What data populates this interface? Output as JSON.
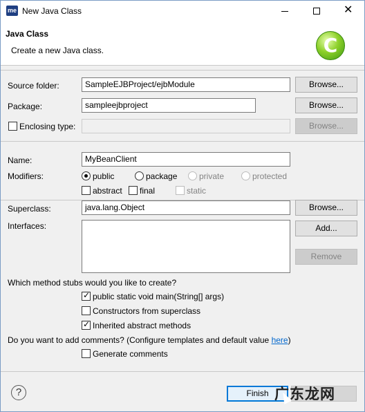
{
  "window": {
    "app_icon_text": "me",
    "title": "New Java Class",
    "minimize_icon": "minimize-icon",
    "maximize_icon": "maximize-icon",
    "close_icon": "close-icon"
  },
  "header": {
    "title": "Java Class",
    "subtitle": "Create a new Java class.",
    "class_icon_letter": "C"
  },
  "source_folder": {
    "label": "Source folder:",
    "value": "SampleEJBProject/ejbModule",
    "browse": "Browse..."
  },
  "package": {
    "label": "Package:",
    "value": "sampleejbproject",
    "browse": "Browse..."
  },
  "enclosing_type": {
    "label": "Enclosing type:",
    "checked": false,
    "value": "",
    "browse": "Browse..."
  },
  "name": {
    "label": "Name:",
    "value": "MyBeanClient"
  },
  "modifiers": {
    "label": "Modifiers:",
    "public": "public",
    "package": "package",
    "private": "private",
    "protected": "protected",
    "selected": "public",
    "abstract": "abstract",
    "final": "final",
    "static": "static"
  },
  "superclass": {
    "label": "Superclass:",
    "value": "java.lang.Object",
    "browse": "Browse..."
  },
  "interfaces": {
    "label": "Interfaces:",
    "add": "Add...",
    "remove": "Remove"
  },
  "stubs": {
    "question": "Which method stubs would you like to create?",
    "main": {
      "label": "public static void main(String[] args)",
      "checked": true
    },
    "constructors": {
      "label": "Constructors from superclass",
      "checked": false
    },
    "inherited": {
      "label": "Inherited abstract methods",
      "checked": true
    }
  },
  "comments": {
    "question": "Do you want to add comments? (Configure templates and default value ",
    "link": "here",
    "close_paren": ")",
    "generate": {
      "label": "Generate comments",
      "checked": false
    }
  },
  "footer": {
    "help_icon": "?",
    "finish": "Finish",
    "watermark": "广东龙网"
  }
}
